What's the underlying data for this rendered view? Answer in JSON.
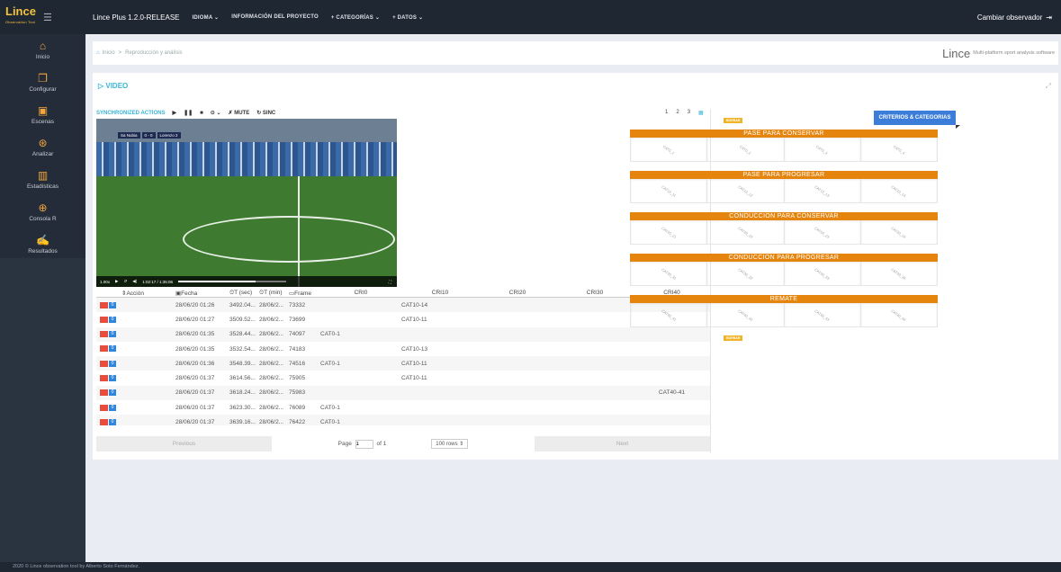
{
  "brand": {
    "name": "Lince",
    "sub": "Observation Tool"
  },
  "topbar": {
    "version": "Lince Plus 1.2.0-RELEASE",
    "menus": [
      "IDIOMA ⌄",
      "INFORMACIÓN DEL PROYECTO",
      "+ CATEGORÍAS ⌄",
      "+ DATOS ⌄"
    ],
    "change_observer": "Cambiar observador"
  },
  "sidebar": {
    "items": [
      {
        "label": "Inicio",
        "icon": "home-icon"
      },
      {
        "label": "Configurar",
        "icon": "configure-icon"
      },
      {
        "label": "Escenas",
        "icon": "scenes-icon"
      },
      {
        "label": "Analizar",
        "icon": "analyze-icon"
      },
      {
        "label": "Estadísticas",
        "icon": "stats-icon"
      },
      {
        "label": "Consola R",
        "icon": "console-icon"
      },
      {
        "label": "Resultados",
        "icon": "results-icon"
      }
    ]
  },
  "breadcrumb": {
    "home": "Inicio",
    "sep": ">",
    "current": "Reproducción y análisis"
  },
  "header_right": {
    "logo": "Lince",
    "tagline": "Multi-platform sport analysis software"
  },
  "video_section": {
    "title": "VIDEO"
  },
  "sync_bar": {
    "label": "SYNCHRONIZED ACTIONS",
    "mute": "MUTE",
    "sinc": "SINC"
  },
  "page_numbers": [
    "1",
    "2",
    "3"
  ],
  "video": {
    "team_home": "Sa Nubia",
    "score": "0 - 0",
    "team_away": "Lorenzo 2",
    "speed": "1.00x",
    "time": "1:02:17 / 1:35:06",
    "progress": 0.72
  },
  "table": {
    "headers": [
      "Acción",
      "Fecha",
      "T (sec)",
      "T (min)",
      "Frame",
      "CRI0",
      "CRI10",
      "CRI20",
      "CRI30",
      "CRI40"
    ],
    "rows": [
      {
        "fecha": "28/06/20 01:26",
        "tsec": "3492.04...",
        "tmin": "28/06/2...",
        "frame": "73332",
        "cri0": "",
        "cri10": "CAT10-14",
        "cri40": ""
      },
      {
        "fecha": "28/06/20 01:27",
        "tsec": "3509.52...",
        "tmin": "28/06/2...",
        "frame": "73699",
        "cri0": "",
        "cri10": "CAT10-11",
        "cri40": ""
      },
      {
        "fecha": "28/06/20 01:35",
        "tsec": "3528.44...",
        "tmin": "28/06/2...",
        "frame": "74097",
        "cri0": "CAT0-1",
        "cri10": "",
        "cri40": ""
      },
      {
        "fecha": "28/06/20 01:35",
        "tsec": "3532.54...",
        "tmin": "28/06/2...",
        "frame": "74183",
        "cri0": "",
        "cri10": "CAT10-13",
        "cri40": ""
      },
      {
        "fecha": "28/06/20 01:36",
        "tsec": "3548.39...",
        "tmin": "28/06/2...",
        "frame": "74516",
        "cri0": "CAT0-1",
        "cri10": "CAT10-11",
        "cri40": ""
      },
      {
        "fecha": "28/06/20 01:37",
        "tsec": "3614.56...",
        "tmin": "28/06/2...",
        "frame": "75905",
        "cri0": "",
        "cri10": "CAT10-11",
        "cri40": ""
      },
      {
        "fecha": "28/06/20 01:37",
        "tsec": "3618.24...",
        "tmin": "28/06/2...",
        "frame": "75983",
        "cri0": "",
        "cri10": "",
        "cri40": "CAT40-41"
      },
      {
        "fecha": "28/06/20 01:37",
        "tsec": "3623.30...",
        "tmin": "28/06/2...",
        "frame": "76089",
        "cri0": "CAT0-1",
        "cri10": "",
        "cri40": ""
      },
      {
        "fecha": "28/06/20 01:37",
        "tsec": "3639.16...",
        "tmin": "28/06/2...",
        "frame": "76422",
        "cri0": "CAT0-1",
        "cri10": "",
        "cri40": ""
      }
    ]
  },
  "pager": {
    "previous": "Previous",
    "page_label": "Page",
    "page_value": "1",
    "of": "of 1",
    "rows": "100 rows ⇕",
    "next": "Next"
  },
  "criteria": {
    "button": "CRITERIOS & CATEGORIAS",
    "borrar": "BORRAR",
    "groups": [
      {
        "title": "PASE PARA CONSERVAR",
        "cells": [
          "CAT0_1",
          "CAT0_2",
          "CAT0_3",
          "CAT0_4"
        ]
      },
      {
        "title": "PASE PARA PROGRESAR",
        "cells": [
          "CAT10_11",
          "CAT10_12",
          "CAT10_13",
          "CAT10_14"
        ]
      },
      {
        "title": "CONDUCCIÓN PARA CONSERVAR",
        "cells": [
          "CAT20_21",
          "CAT20_22",
          "CAT20_23",
          "CAT20_24"
        ]
      },
      {
        "title": "CONDUCCIÓN PARA PROGRESAR",
        "cells": [
          "CAT30_31",
          "CAT30_32",
          "CAT30_33",
          "CAT30_34"
        ]
      },
      {
        "title": "REMATE",
        "cells": [
          "CAT40_41",
          "CAT40_42",
          "CAT40_43",
          "CAT40_44"
        ]
      }
    ]
  },
  "footer": {
    "text": "2020 © Lince observation tool by Alberto Soto Fernández."
  },
  "colors": {
    "topbar": "#1f2733",
    "accent": "#39b6d6",
    "orange": "#e5850d",
    "button_blue": "#3b7dd8",
    "red": "#e74c3c"
  }
}
